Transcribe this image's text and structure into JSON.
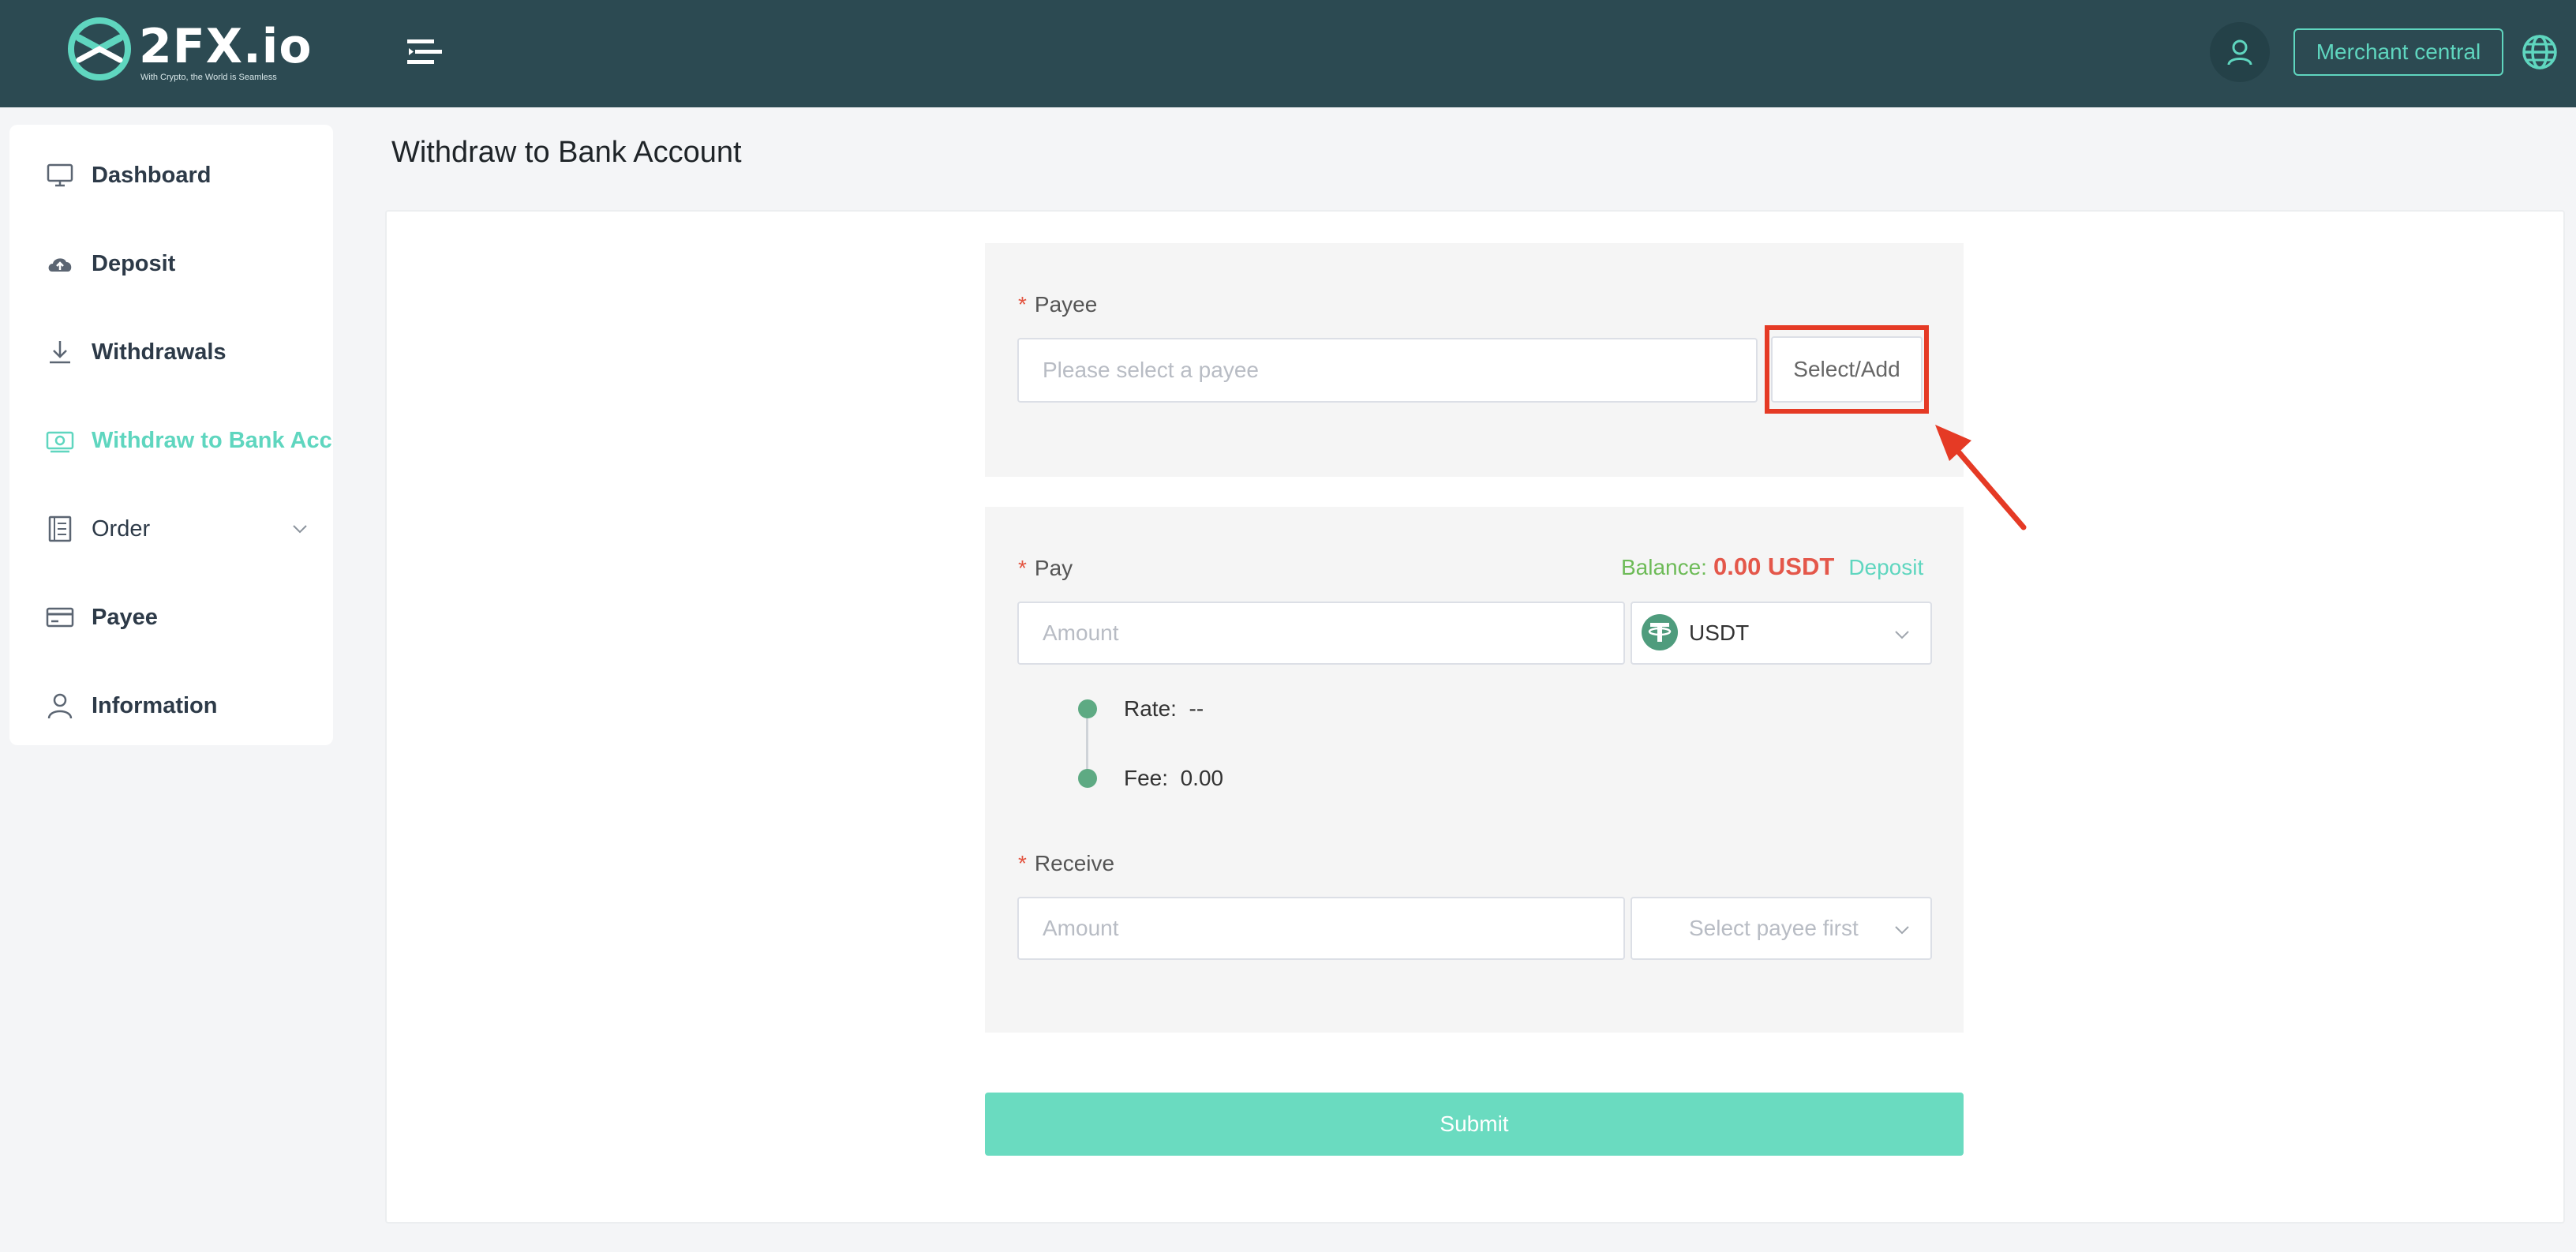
{
  "brand": {
    "name": "2FX.io",
    "tagline": "With Crypto, the World is Seamless"
  },
  "header": {
    "merchant_label": "Merchant central"
  },
  "sidebar": {
    "items": [
      {
        "label": "Dashboard",
        "icon": "monitor-icon"
      },
      {
        "label": "Deposit",
        "icon": "cloud-upload-icon"
      },
      {
        "label": "Withdrawals",
        "icon": "download-icon"
      },
      {
        "label": "Withdraw to Bank Account",
        "icon": "bank-cash-icon",
        "active": true
      },
      {
        "label": "Order",
        "icon": "document-list-icon",
        "expandable": true
      },
      {
        "label": "Payee",
        "icon": "credit-card-icon"
      },
      {
        "label": "Information",
        "icon": "user-icon"
      }
    ]
  },
  "page": {
    "title": "Withdraw to Bank Account"
  },
  "form": {
    "payee": {
      "label": "Payee",
      "placeholder": "Please select a payee",
      "button_label": "Select/Add"
    },
    "pay": {
      "label": "Pay",
      "balance_label": "Balance:",
      "balance_value": "0.00 USDT",
      "deposit_link": "Deposit",
      "amount_placeholder": "Amount",
      "currency": "USDT"
    },
    "rate": {
      "label": "Rate:",
      "value": "--"
    },
    "fee": {
      "label": "Fee:",
      "value": "0.00"
    },
    "receive": {
      "label": "Receive",
      "amount_placeholder": "Amount",
      "currency_placeholder": "Select payee first"
    },
    "required_mark": "*",
    "submit_label": "Submit"
  },
  "colors": {
    "topbar": "#2c4a52",
    "accent": "#5fd6bf",
    "submit": "#6adbc0",
    "balance_label": "#6dbb57",
    "balance_value": "#e4574a",
    "highlight": "#e53a25",
    "tether": "#4f9c7d"
  }
}
